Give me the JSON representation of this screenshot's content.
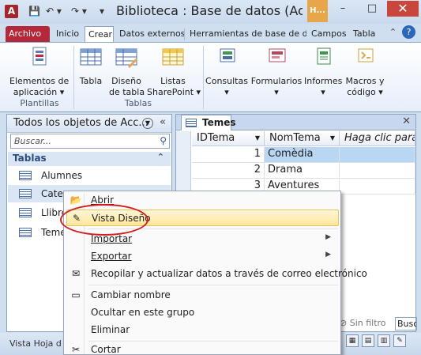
{
  "window": {
    "title": "Biblioteca : Base de datos (Acces...",
    "app_logo": "A",
    "context_tab": "H...",
    "minimize": "–",
    "maximize": "□",
    "close": "✕"
  },
  "qat": {
    "save": "💾",
    "undo": "↶ ▾",
    "redo": "↷ ▾",
    "customize": "▾"
  },
  "tabs": [
    {
      "label": "Archivo"
    },
    {
      "label": "Inicio"
    },
    {
      "label": "Crear"
    },
    {
      "label": "Datos externos"
    },
    {
      "label": "Herramientas de base de da"
    },
    {
      "label": "Campos"
    },
    {
      "label": "Tabla"
    }
  ],
  "ribbon": {
    "app_parts": "Elementos de\naplicación ▾",
    "group_plantillas": "Plantillas",
    "tabla": "Tabla",
    "diseno_tabla": "Diseño\nde tabla",
    "listas_sp": "Listas\nSharePoint ▾",
    "group_tablas": "Tablas",
    "consultas": "Consultas\n▾",
    "formularios": "Formularios\n▾",
    "informes": "Informes\n▾",
    "macros": "Macros y\ncódigo ▾"
  },
  "nav": {
    "title": "Todos los objetos de Acc...",
    "collapse": "«",
    "search_placeholder": "Buscar...",
    "group": "Tablas",
    "group_chevron": "⌃",
    "items": [
      "Alumnes",
      "Categ",
      "Llibre",
      "Temes"
    ]
  },
  "doc": {
    "tab": "Temes",
    "close": "✕",
    "columns": [
      "IDTema",
      "NomTema",
      "Haga clic para ag"
    ],
    "rows": [
      {
        "id": "1",
        "name": "Comèdia"
      },
      {
        "id": "2",
        "name": "Drama"
      },
      {
        "id": "3",
        "name": "Aventures"
      }
    ],
    "filter": "Sin filtro",
    "search": "Busc"
  },
  "status": {
    "text": "Vista Hoja d"
  },
  "menu": {
    "items": [
      {
        "label": "Abrir"
      },
      {
        "label": "Vista Diseño"
      },
      {
        "label": "Importar"
      },
      {
        "label": "Exportar"
      },
      {
        "label": "Recopilar y actualizar datos a través de correo electrónico"
      },
      {
        "label": "Cambiar nombre"
      },
      {
        "label": "Ocultar en este grupo"
      },
      {
        "label": "Eliminar"
      },
      {
        "label": "Cortar"
      }
    ]
  },
  "colors": {
    "file_tab": "#b5283a",
    "highlight": "#ffe79a",
    "annotation": "#d21f1f"
  }
}
